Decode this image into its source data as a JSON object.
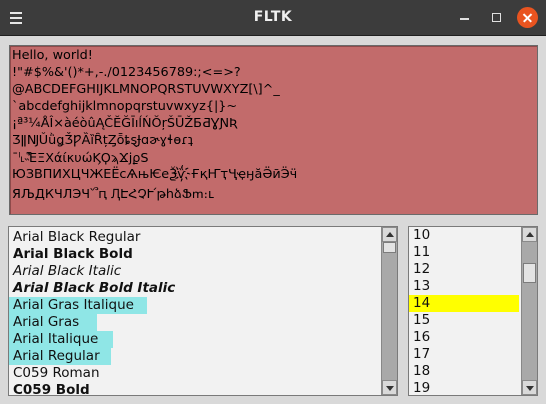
{
  "window": {
    "title": "FLTK",
    "menu_icon": "hamburger-menu-icon",
    "minimize_icon": "minimize-icon",
    "maximize_icon": "maximize-icon",
    "close_icon": "close-icon",
    "close_color": "#e95420"
  },
  "preview": {
    "background": "#c26b6b",
    "lines": [
      "Hello, world!",
      "!\"#$%&'()*+,-./0123456789:;<=>?",
      "@ABCDEFGHIJKLMNOPQRSTUVWXYZ[\\]^_",
      "`abcdefghijklmnopqrstuvwxyz{|}~",
      "¡ª³¼ÅÎ×àéòûĄČĔĞĪıĺŃŎŗŠŪŽƂƋƔƝƦ",
      "ƷǁǊǓǜǥǮǷȀȉȒțȤȭȶȿɈɑɚɣɬɵɾʇ",
      "ˉˡ˪˵̓̽͆ΕΞΧάίκυώϏϘϡϪϳϼЅ",
      "ЮЗВПИХЦЧЖЕЁсѦњѤеѮѷ҉ҒқҤҭҶҿӈӑӚӣӬӵ",
      "ЯЉДКЧЛЭЧ՝՞ԥ ԮԷՀՉՒ՛թհձՖՠ։ւ"
    ]
  },
  "fonts": {
    "items": [
      {
        "label": "Arial Black Regular",
        "style": "normal",
        "highlight": false
      },
      {
        "label": "Arial Black Bold",
        "style": "bold",
        "highlight": false
      },
      {
        "label": "Arial Black Italic",
        "style": "italic",
        "highlight": false
      },
      {
        "label": "Arial Black Bold Italic",
        "style": "bold-italic",
        "highlight": false
      },
      {
        "label": "Arial Gras Italique",
        "style": "normal",
        "highlight": true
      },
      {
        "label": "Arial Gras",
        "style": "normal",
        "highlight": true
      },
      {
        "label": "Arial Italique",
        "style": "normal",
        "highlight": true
      },
      {
        "label": "Arial Regular",
        "style": "normal",
        "highlight": true
      },
      {
        "label": "C059 Roman",
        "style": "normal",
        "highlight": false
      },
      {
        "label": "C059 Bold",
        "style": "bold",
        "highlight": false
      }
    ],
    "highlight_color": "#8fe6e6"
  },
  "sizes": {
    "items": [
      "10",
      "11",
      "12",
      "13",
      "14",
      "15",
      "16",
      "17",
      "18",
      "19"
    ],
    "selected": "14",
    "selected_color": "#ffff00"
  }
}
